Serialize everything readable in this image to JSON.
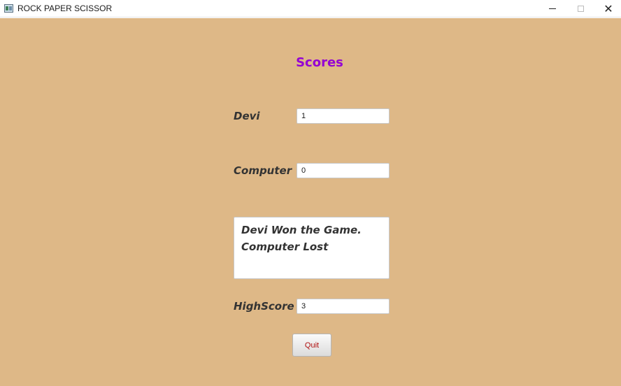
{
  "window": {
    "title": "ROCK PAPER SCISSOR",
    "icon": "app-window-icon",
    "controls": {
      "minimize": "minimize-icon",
      "maximize": "maximize-icon",
      "close": "✕"
    }
  },
  "scores": {
    "heading": "Scores",
    "player": {
      "label": "Devi",
      "value": "1"
    },
    "computer": {
      "label": "Computer",
      "value": "0"
    },
    "result": {
      "line1": "Devi Won the Game.",
      "line2": "Computer Lost"
    },
    "highscore": {
      "label": "HighScore",
      "value": "3"
    }
  },
  "actions": {
    "quit_label": "Quit"
  },
  "colors": {
    "background": "#deb887",
    "heading": "#9400d3",
    "label": "#333333",
    "quit_text": "#b01010"
  }
}
